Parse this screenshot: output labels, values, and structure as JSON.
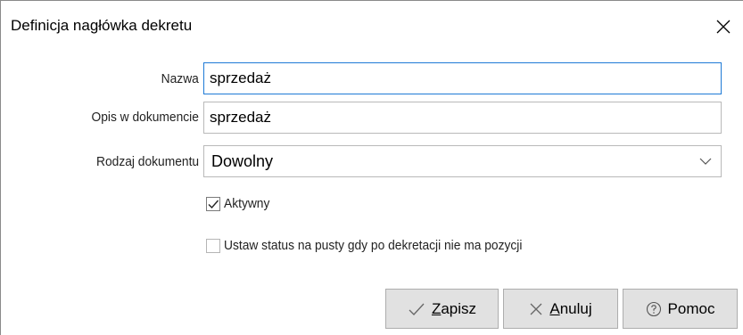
{
  "window": {
    "title": "Definicja nagłówka dekretu"
  },
  "form": {
    "name": {
      "label": "Nazwa",
      "value": "sprzedaż"
    },
    "description": {
      "label": "Opis w dokumencie",
      "value": "sprzedaż"
    },
    "document_type": {
      "label": "Rodzaj dokumentu",
      "value": "Dowolny"
    },
    "active": {
      "label": "Aktywny",
      "checked": true
    },
    "empty_status": {
      "label": "Ustaw status na pusty gdy po dekretacji nie ma pozycji",
      "checked": false
    }
  },
  "buttons": {
    "save": {
      "accel": "Z",
      "rest": "apisz",
      "icon": "check-icon"
    },
    "cancel": {
      "accel": "A",
      "rest": "nuluj",
      "icon": "x-icon"
    },
    "help": {
      "label": "Pomoc",
      "icon": "help-circle-icon"
    }
  },
  "colors": {
    "focus_border": "#1e7ad6",
    "button_face": "#e1e1e1",
    "button_border": "#adadad"
  }
}
